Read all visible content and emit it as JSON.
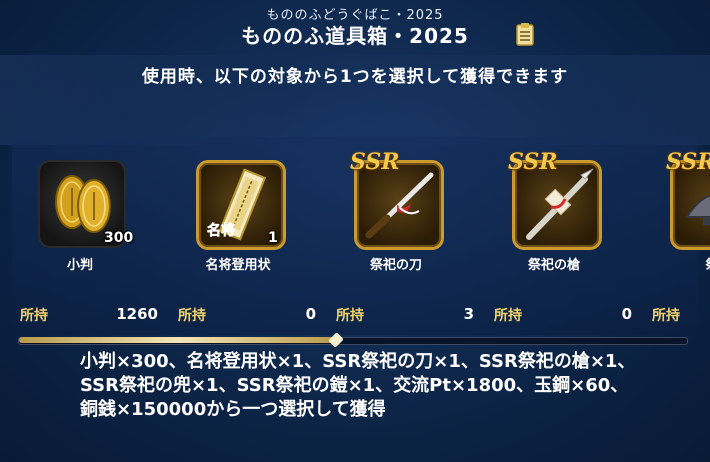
{
  "header": {
    "ruby": "もののふどうぐばこ・2025",
    "title": "もののふ道具箱・2025"
  },
  "subtitle": "使用時、以下の対象から1つを選択して獲得できます",
  "owned_label": "所持",
  "items": [
    {
      "name": "小判",
      "quantity": "300",
      "owned": "1260",
      "rarity": "",
      "icon": "koban-coins-icon"
    },
    {
      "name": "名将登用状",
      "quantity": "1",
      "owned": "0",
      "rarity": "",
      "icon": "scroll-ticket-icon"
    },
    {
      "name": "祭祀の刀",
      "quantity": "",
      "owned": "3",
      "rarity": "SSR",
      "icon": "sword-icon"
    },
    {
      "name": "祭祀の槍",
      "quantity": "",
      "owned": "0",
      "rarity": "SSR",
      "icon": "spear-icon"
    },
    {
      "name": "祭",
      "quantity": "",
      "owned": "",
      "rarity": "SSR",
      "icon": "helmet-icon"
    }
  ],
  "ticket_text": "名将",
  "description": "小判×300、名将登用状×1、SSR祭祀の刀×1、SSR祭祀の槍×1、SSR祭祀の兜×1、SSR祭祀の鎧×1、交流Pt×1800、玉鋼×60、銅銭×150000から一つ選択して獲得",
  "scroll": {
    "position": 0.47
  },
  "colors": {
    "gold": "#f2d36a",
    "frame_gold": "#c99a2e",
    "background": "#0d2548"
  }
}
